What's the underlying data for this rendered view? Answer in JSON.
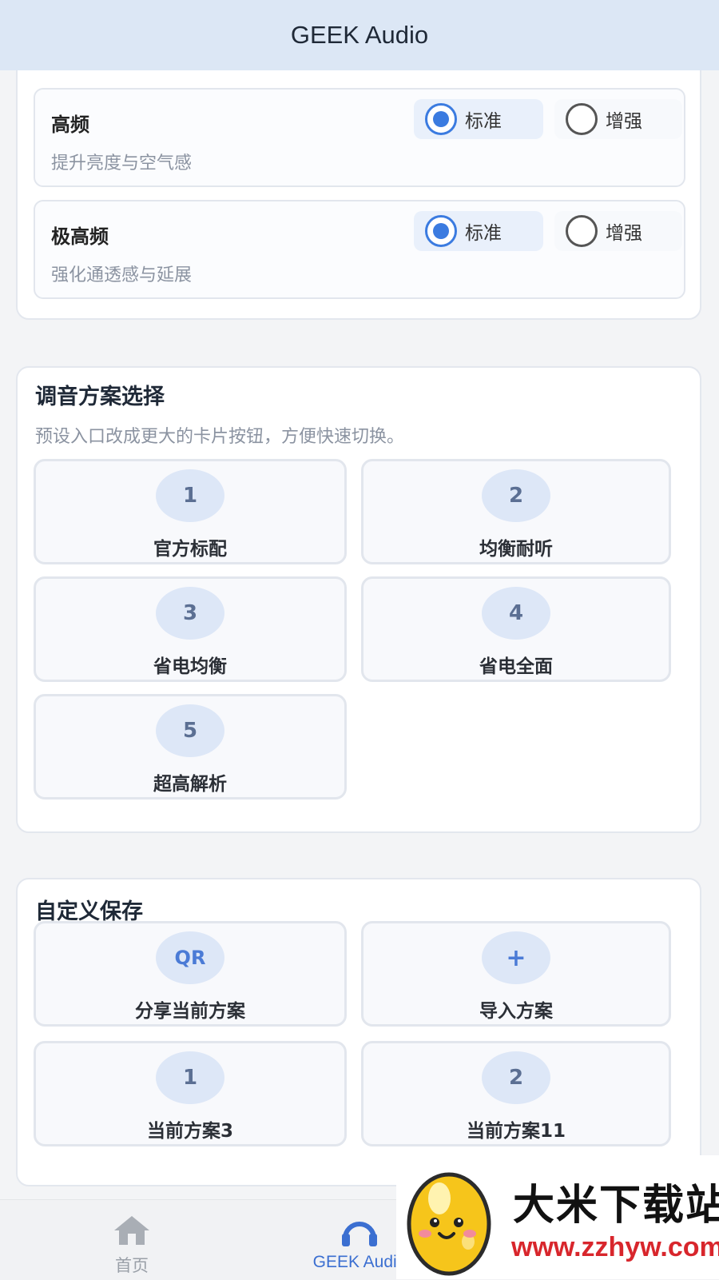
{
  "app_title": "GEEK Audio",
  "bands": [
    {
      "title": "高频",
      "desc": "提升亮度与空气感",
      "option_standard": "标准",
      "option_enhanced": "增强",
      "selected": "标准"
    },
    {
      "title": "极高频",
      "desc": "强化通透感与延展",
      "option_standard": "标准",
      "option_enhanced": "增强",
      "selected": "标准"
    }
  ],
  "presets": {
    "title": "调音方案选择",
    "desc": "预设入口改成更大的卡片按钮，方便快速切换。",
    "items": [
      {
        "badge": "1",
        "label": "官方标配"
      },
      {
        "badge": "2",
        "label": "均衡耐听"
      },
      {
        "badge": "3",
        "label": "省电均衡"
      },
      {
        "badge": "4",
        "label": "省电全面"
      },
      {
        "badge": "5",
        "label": "超高解析"
      }
    ]
  },
  "custom": {
    "title": "自定义保存",
    "items": [
      {
        "badge": "QR",
        "label": "分享当前方案"
      },
      {
        "badge": "+",
        "label": "导入方案"
      },
      {
        "badge": "1",
        "label": "当前方案3"
      },
      {
        "badge": "2",
        "label": "当前方案11"
      }
    ]
  },
  "nav": {
    "home_label": "首页",
    "geek_label": "GEEK Audio"
  },
  "watermark": {
    "brand": "大米下载站",
    "url": "www.zzhyw.com"
  },
  "colors": {
    "accent": "#3b7be0",
    "header_bg": "#dce7f5",
    "badge_bg": "#dde7f7"
  }
}
